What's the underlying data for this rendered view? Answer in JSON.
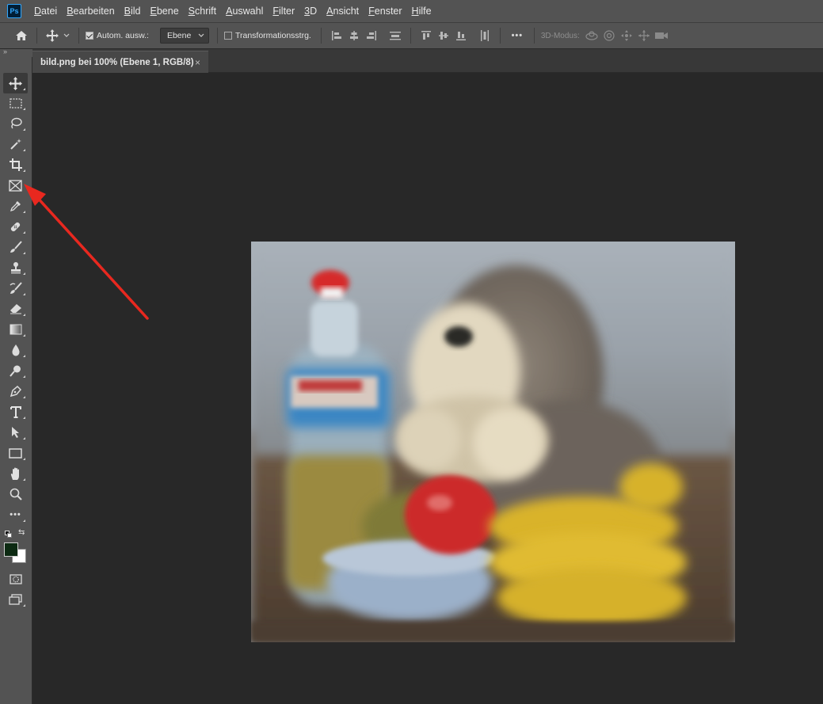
{
  "app": {
    "logo_text": "Ps"
  },
  "menu": {
    "items": [
      {
        "underline": "D",
        "rest": "atei"
      },
      {
        "underline": "B",
        "rest": "earbeiten"
      },
      {
        "underline": "B",
        "rest": "ild"
      },
      {
        "underline": "E",
        "rest": "bene"
      },
      {
        "underline": "S",
        "rest": "chrift"
      },
      {
        "underline": "A",
        "rest": "uswahl"
      },
      {
        "underline": "F",
        "rest": "ilter"
      },
      {
        "underline": "3",
        "rest": "D"
      },
      {
        "underline": "A",
        "rest": "nsicht"
      },
      {
        "underline": "F",
        "rest": "enster"
      },
      {
        "underline": "H",
        "rest": "ilfe"
      }
    ]
  },
  "options": {
    "auto_select_label": "Autom. ausw.:",
    "auto_select_checked": true,
    "layer_select_value": "Ebene",
    "transform_label": "Transformationsstrg.",
    "transform_checked": false,
    "more_label": "•••",
    "mode_3d_label": "3D-Modus:"
  },
  "toolbar": {
    "collapse_glyph": "»",
    "tools": [
      {
        "name": "move-tool",
        "icon": "move-icon"
      },
      {
        "name": "marquee-tool",
        "icon": "rect-marquee-icon"
      },
      {
        "name": "lasso-tool",
        "icon": "lasso-icon"
      },
      {
        "name": "magic-wand-tool",
        "icon": "magic-wand-icon"
      },
      {
        "name": "crop-tool",
        "icon": "crop-icon"
      },
      {
        "name": "frame-tool",
        "icon": "frame-icon"
      },
      {
        "name": "eyedropper-tool",
        "icon": "eyedropper-icon"
      },
      {
        "name": "healing-brush-tool",
        "icon": "bandage-icon"
      },
      {
        "name": "brush-tool",
        "icon": "brush-icon"
      },
      {
        "name": "clone-stamp-tool",
        "icon": "stamp-icon"
      },
      {
        "name": "history-brush-tool",
        "icon": "history-brush-icon"
      },
      {
        "name": "eraser-tool",
        "icon": "eraser-icon"
      },
      {
        "name": "gradient-tool",
        "icon": "gradient-icon"
      },
      {
        "name": "blur-tool",
        "icon": "drop-icon"
      },
      {
        "name": "dodge-tool",
        "icon": "dodge-icon"
      },
      {
        "name": "pen-tool",
        "icon": "pen-icon"
      },
      {
        "name": "type-tool",
        "icon": "type-icon"
      },
      {
        "name": "path-selection-tool",
        "icon": "arrow-cursor-icon"
      },
      {
        "name": "rectangle-tool",
        "icon": "rectangle-icon"
      },
      {
        "name": "hand-tool",
        "icon": "hand-icon"
      },
      {
        "name": "zoom-tool",
        "icon": "magnifier-icon"
      },
      {
        "name": "edit-toolbar",
        "icon": "more-icon"
      }
    ],
    "foreground_color": "#0c2a12",
    "background_color": "#ffffff"
  },
  "document": {
    "tab_title": "bild.png bei 100% (Ebene 1, RGB/8)",
    "close_glyph": "×"
  },
  "colors": {
    "annotation_arrow": "#e8281f"
  }
}
